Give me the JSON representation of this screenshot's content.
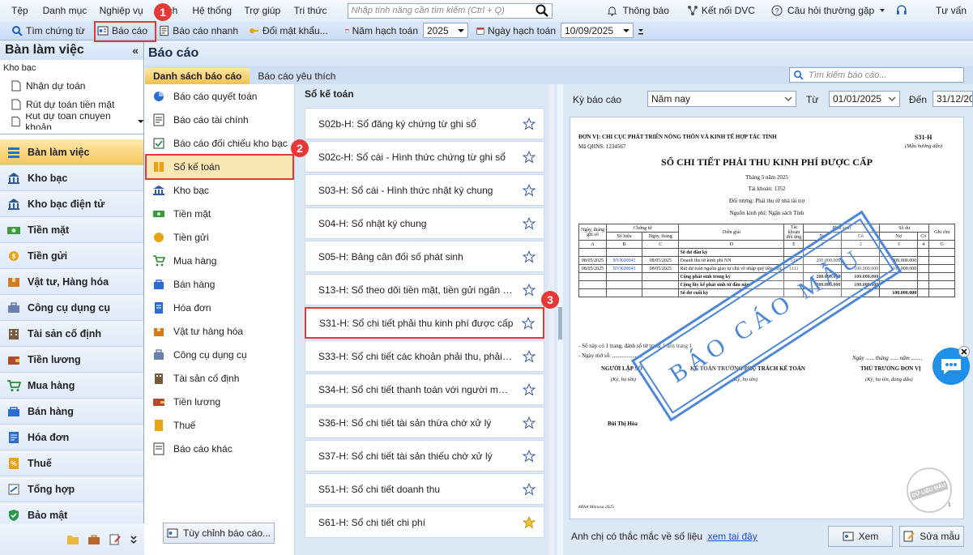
{
  "menu": [
    "Tệp",
    "Danh mục",
    "Nghiệp vụ",
    "ch",
    "Hệ thống",
    "Trợ giúp",
    "Tri thức"
  ],
  "menu_search_placeholder": "Nhập tính năng cần tìm kiếm (Ctrl + Q)",
  "menu_right": {
    "notify": "Thông báo",
    "connect": "Kết nối DVC",
    "faq": "Câu hỏi thường gặp",
    "support": "Tư vấn"
  },
  "toolbar": {
    "find_docs": "Tìm chứng từ",
    "reports": "Báo cáo",
    "quick_report": "Báo cáo nhanh",
    "change_password": "Đổi mật khẩu...",
    "fiscal_year_label": "Năm hạch toán",
    "fiscal_year": "2025",
    "fiscal_date_label": "Ngày hạch toán",
    "fiscal_date": "10/09/2025"
  },
  "left": {
    "title": "Bàn làm việc",
    "tree_group": "Kho bạc",
    "tree_items": [
      "Nhận dự toán",
      "Rút dự toán tiền mặt",
      "Rút dự toán chuyển khoản"
    ],
    "nav": [
      "Bàn làm việc",
      "Kho bạc",
      "Kho bạc điện tử",
      "Tiền mặt",
      "Tiền gửi",
      "Vật tư, Hàng hóa",
      "Công cụ dụng cụ",
      "Tài sản cố định",
      "Tiền lương",
      "Mua hàng",
      "Bán hàng",
      "Hóa đơn",
      "Thuế",
      "Tổng hợp",
      "Bảo mật"
    ]
  },
  "main": {
    "title": "Báo cáo",
    "tabs": [
      "Danh sách báo cáo",
      "Báo cáo yêu thích"
    ],
    "search_placeholder": "Tìm kiếm báo cáo...",
    "categories": [
      "Báo cáo quyết toán",
      "Báo cáo tài chính",
      "Báo cáo đối chiếu kho bạc",
      "Sổ kế toán",
      "Kho bạc",
      "Tiền mặt",
      "Tiền gửi",
      "Mua hàng",
      "Bán hàng",
      "Hóa đơn",
      "Vật tư hàng hóa",
      "Công cụ dụng cụ",
      "Tài sản cố định",
      "Tiền lương",
      "Thuế",
      "Báo cáo khác"
    ],
    "customize_button": "Tùy chỉnh báo cáo...",
    "list_title": "Sổ kế toán",
    "reports": [
      "S02b-H: Sổ đăng ký chứng từ ghi sổ",
      "S02c-H: Sổ cái - Hình thức chứng từ ghi sổ",
      "S03-H: Sổ cái - Hình thức nhật ký chung",
      "S04-H: Sổ nhật ký chung",
      "S05-H: Bảng cân đối số phát sinh",
      "S13-H: Sổ theo dõi tiền mặt, tiền gửi ngân hà...",
      "S31-H: Sổ chi tiết phải thu kinh phí được cấp",
      "S33-H: Sổ chi tiết các khoản phải thu, phải tr...",
      "S34-H: Sổ chi tiết thanh toán với người mua,...",
      "S36-H: Sổ chi tiết tài sản thừa chờ xử lý",
      "S37-H: Sổ chi tiết tài sản thiếu chờ xử lý",
      "S51-H: Sổ chi tiết doanh thu",
      "S61-H: Sổ chi tiết chi phí"
    ],
    "favorite_index": 12
  },
  "preview": {
    "period_label": "Kỳ báo cáo",
    "period": "Năm nay",
    "from_label": "Từ",
    "from": "01/01/2025",
    "to_label": "Đến",
    "to": "31/12/20",
    "footer_text": "Anh chị có thắc mắc về số liệu",
    "footer_link": "xem tai đây",
    "view_button": "Xem",
    "edit_button": "Sửa mẫu"
  },
  "paper": {
    "unit": "ĐƠN VỊ: CHI CỤC PHÁT TRIỂN NÔNG THÔN VÀ KINH TẾ HỢP TÁC TỈNH",
    "code": "Mã QHNS: 1234567",
    "form": "S31-H",
    "form_note": "(Mẫu hướng dẫn)",
    "heading": "SỔ CHI TIẾT PHẢI THU KINH PHÍ ĐƯỢC CẤP",
    "month": "Tháng 5 năm 2025",
    "account": "Tài khoản: 1352",
    "object": "Đối tượng: Phải thu từ nhà tài trợ",
    "source": "Nguồn kinh phí: Ngân sách Tỉnh",
    "stamp": "BÁO CÁO MẪU",
    "pages_note": "- Sổ này có 1 trang, đánh số từ trang 1 đến trang 1",
    "open_date": "- Ngày mở sổ: ......................",
    "date_line": "Ngày ...... tháng ...... năm ........",
    "signers": [
      "NGƯỜI LẬP SỔ",
      "KẾ TOÁN TRƯỞNG/PHỤ TRÁCH KẾ TOÁN",
      "THỦ TRƯỞNG ĐƠN VỊ"
    ],
    "signer_notes": [
      "(Ký, họ tên)",
      "(Ký, họ tên)",
      "(Ký, họ tên, đóng dấu)"
    ],
    "preparer": "Bùi Thị Hòa",
    "seal": "DỮ LIỆU MẪU",
    "software": "MISA Mimosa 2025",
    "page": "1",
    "table": {
      "headers": [
        "Ngày, tháng ghi sổ",
        "Chứng từ",
        "Diễn giải",
        "Tài khoản đối ứng",
        "Phát sinh",
        "Số dư",
        "Ghi chú"
      ],
      "subheaders": [
        "Số hiệu",
        "Ngày, tháng",
        "Nợ",
        "Có",
        "Nợ",
        "Có"
      ],
      "letters": [
        "A",
        "B",
        "C",
        "D",
        "E",
        "1",
        "2",
        "3",
        "4",
        "G"
      ],
      "rows": [
        [
          "",
          "",
          "",
          "Số dư đầu kỳ",
          "",
          "",
          "",
          "",
          "",
          ""
        ],
        [
          "08/05/2025",
          "NVK00043",
          "08/05/2025",
          "Doanh thu từ kinh phí NN",
          "511",
          "200.000.000",
          "",
          "200.000.000",
          "",
          ""
        ],
        [
          "08/05/2025",
          "NVK00043",
          "08/05/2025",
          "Rút dự toán nguồn giao tự chủ về nhập quỹ tiền mặt",
          "1111",
          "",
          "100.000.000",
          "100.000.000",
          "",
          ""
        ],
        [
          "",
          "",
          "",
          "Cộng phát sinh trong kỳ",
          "",
          "200.000.000",
          "100.000.000",
          "",
          "",
          ""
        ],
        [
          "",
          "",
          "",
          "Cộng lũy kế phát sinh từ đầu năm",
          "",
          "200.000.000",
          "100.000.000",
          "",
          "",
          ""
        ],
        [
          "",
          "",
          "",
          "Số dư cuối kỳ",
          "",
          "",
          "",
          "100.000.000",
          "",
          ""
        ]
      ]
    }
  },
  "markers": [
    "1",
    "2",
    "3"
  ],
  "colors": {
    "highlight": "#e53935",
    "active": "#f4c04d",
    "link": "#1a4fd6",
    "stamp": "#4d87d8"
  }
}
